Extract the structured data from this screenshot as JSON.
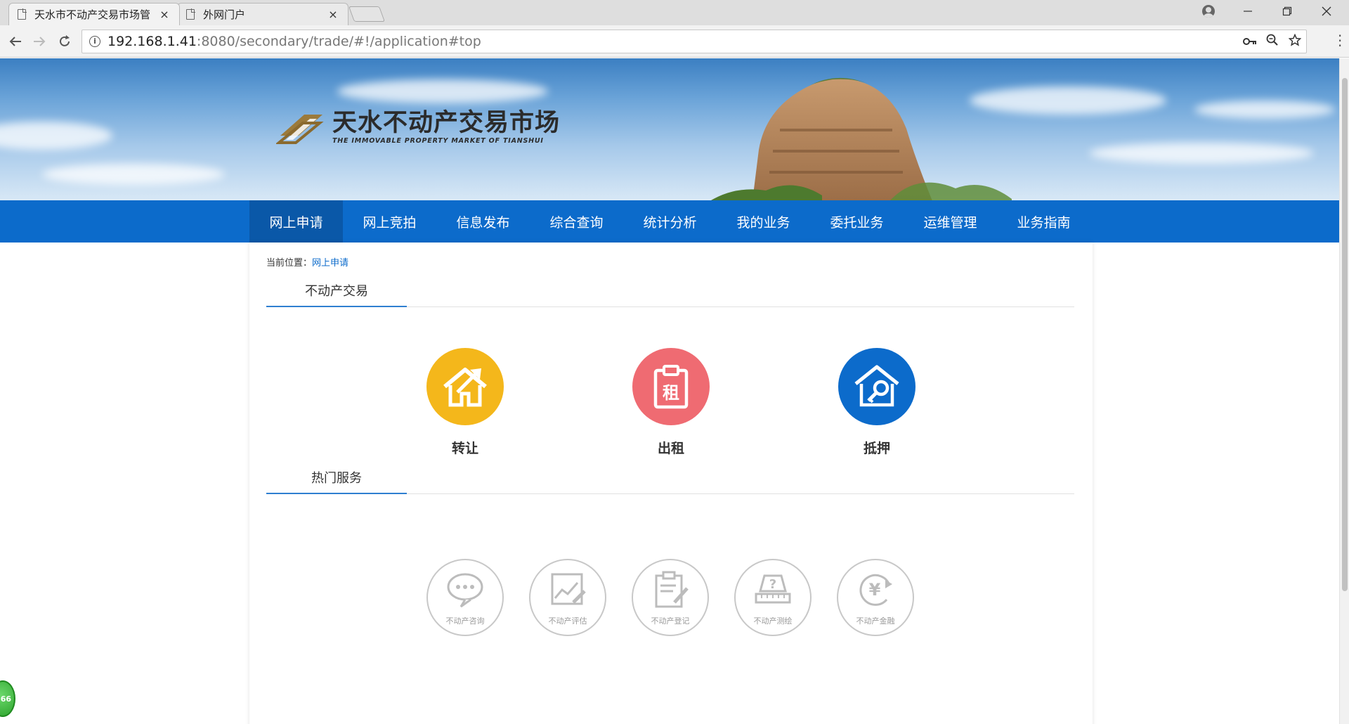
{
  "browser": {
    "tabs": [
      {
        "title": "天水市不动产交易市场管",
        "close": "×",
        "active": true
      },
      {
        "title": "外网门户",
        "close": "×",
        "active": false
      }
    ],
    "url_host": "192.168.1.41",
    "url_rest": ":8080/secondary/trade/#!/application#top",
    "icons": [
      "back-icon",
      "forward-icon",
      "reload-icon",
      "info-icon",
      "key-icon",
      "zoom-icon",
      "star-icon",
      "menu-icon",
      "profile-icon",
      "minimize-icon",
      "restore-icon",
      "close-icon"
    ]
  },
  "header": {
    "logo_title": "天水不动产交易市场",
    "logo_subtitle": "THE IMMOVABLE PROPERTY MARKET OF TIANSHUI"
  },
  "nav": {
    "items": [
      "网上申请",
      "网上竞拍",
      "信息发布",
      "综合查询",
      "统计分析",
      "我的业务",
      "委托业务",
      "运维管理",
      "业务指南"
    ],
    "active_index": 0
  },
  "breadcrumb": {
    "prefix": "当前位置：",
    "current": "网上申请"
  },
  "trade_section": {
    "title": "不动产交易",
    "items": [
      {
        "label": "转让",
        "color": "#f4b71b",
        "icon": "house-arrow-icon"
      },
      {
        "label": "出租",
        "color": "#ef6b72",
        "icon": "rent-clipboard-icon"
      },
      {
        "label": "抵押",
        "color": "#0c6bcb",
        "icon": "house-key-icon"
      }
    ],
    "rent_glyph": "租"
  },
  "hot_section": {
    "title": "热门服务",
    "items": [
      {
        "label": "不动产咨询",
        "icon": "chat-bubble-icon"
      },
      {
        "label": "不动产评估",
        "icon": "chart-edit-icon"
      },
      {
        "label": "不动产登记",
        "icon": "clipboard-pen-icon"
      },
      {
        "label": "不动产测绘",
        "icon": "survey-ruler-icon"
      },
      {
        "label": "不动产金融",
        "icon": "yuan-cycle-icon"
      }
    ],
    "yuan_glyph": "¥",
    "question_glyph": "?"
  },
  "float_badge": {
    "text": "66"
  },
  "colors": {
    "nav_blue": "#0c6bcb",
    "nav_active": "#0a58a8",
    "accent_line": "#2f7fd0"
  }
}
